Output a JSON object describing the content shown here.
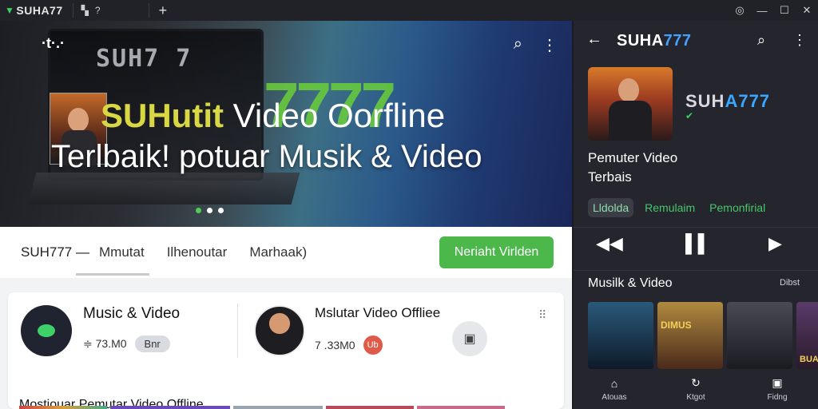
{
  "titlebar": {
    "app_name": "SUHA77",
    "tab2_label": "?",
    "plus": "+",
    "controls": [
      "◎",
      "—",
      "☐",
      "✕"
    ]
  },
  "hero": {
    "top_logo": "·t·.·",
    "monitor_text": "SUH7 7",
    "big_number": "7777",
    "headline_brand": "SUHutit",
    "headline_rest": "Video Oorfline",
    "headline2": "Terlbaik! potuar Musik & Video",
    "search_icon": "search-icon",
    "more_icon": "more-vertical-icon",
    "carousel_dots": 3,
    "active_dot": 0
  },
  "tabs": {
    "brand": "SUH777",
    "dash": "—",
    "items": [
      "Mmutat",
      "Ilhenoutar",
      "Marhaak)"
    ],
    "cta": "Neriaht Virlden"
  },
  "card": {
    "item1_title": "Music & Video",
    "item1_meta": "≑ 73.M0",
    "item1_pill": "Bnr",
    "item2_title": "Mslutar Video Offliee",
    "item2_meta": "7 .33M0",
    "item2_pill": "Ub",
    "section_title": "Mostiouar Pemutar Video Offline"
  },
  "right": {
    "title_a": "SUHA",
    "title_b": "777",
    "logo_a": "SUH",
    "logo_b": "A777",
    "name_line1": "Pemuter Video",
    "name_line2": "Terbais",
    "chips": [
      "Lldolda",
      "Remulaim",
      "Pemonfirial"
    ],
    "active_chip": 0,
    "section": "Musilk & Video",
    "section_link": "Dibst",
    "tiles": [
      {
        "label": "",
        "color": "#1d3b52"
      },
      {
        "label": "DIMUS",
        "color": "#6a3a2a"
      },
      {
        "label": "",
        "color": "#2a2a33"
      },
      {
        "label": "BUAIRAN",
        "color": "#3a2a4a"
      }
    ],
    "nav": [
      {
        "label": "Atouas",
        "icon": "home-icon"
      },
      {
        "label": "Ktgot",
        "icon": "refresh-icon"
      },
      {
        "label": "Fidng",
        "icon": "profile-icon"
      }
    ]
  },
  "colors": {
    "accent_green": "#4cb84c",
    "brand_blue": "#46a0ff",
    "dark_panel": "#24252d"
  }
}
